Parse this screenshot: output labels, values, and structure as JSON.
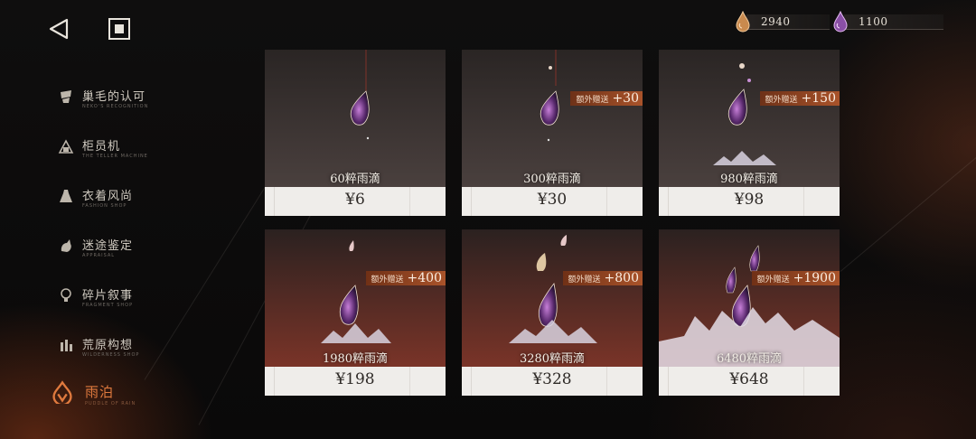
{
  "nav": {
    "back_icon": "back-triangle-icon",
    "home_icon": "home-square-icon"
  },
  "currencies": [
    {
      "icon": "amber-drop-icon",
      "color": "#d99b5c",
      "value": "2940"
    },
    {
      "icon": "violet-drop-icon",
      "color": "#b487c9",
      "value": "1100"
    }
  ],
  "sidebar": {
    "items": [
      {
        "label": "巢毛的认可",
        "sub": "NEKO'S RECOGNITION",
        "icon": "badge-icon"
      },
      {
        "label": "柜员机",
        "sub": "THE TELLER MACHINE",
        "icon": "machine-icon"
      },
      {
        "label": "衣着风尚",
        "sub": "FASHION SHOP",
        "icon": "dress-icon"
      },
      {
        "label": "迷途鉴定",
        "sub": "APPRAISAL",
        "icon": "creature-icon"
      },
      {
        "label": "碎片叙事",
        "sub": "FRAGMENT SHOP",
        "icon": "bulb-icon"
      },
      {
        "label": "荒原构想",
        "sub": "WILDERNESS SHOP",
        "icon": "tower-icon"
      },
      {
        "label": "雨泊",
        "sub": "PUDDLE OF RAIN",
        "icon": "rain-logo-icon",
        "active": true
      }
    ]
  },
  "accent_color": "#e07a3e",
  "shop": {
    "packs": [
      {
        "name": "60粹雨滴",
        "price": "¥6",
        "bonus_label": "",
        "bonus": ""
      },
      {
        "name": "300粹雨滴",
        "price": "¥30",
        "bonus_label": "额外赠送",
        "bonus": "+30"
      },
      {
        "name": "980粹雨滴",
        "price": "¥98",
        "bonus_label": "额外赠送",
        "bonus": "+150"
      },
      {
        "name": "1980粹雨滴",
        "price": "¥198",
        "bonus_label": "额外赠送",
        "bonus": "+400"
      },
      {
        "name": "3280粹雨滴",
        "price": "¥328",
        "bonus_label": "额外赠送",
        "bonus": "+800"
      },
      {
        "name": "6480粹雨滴",
        "price": "¥648",
        "bonus_label": "额外赠送",
        "bonus": "+1900"
      }
    ]
  }
}
